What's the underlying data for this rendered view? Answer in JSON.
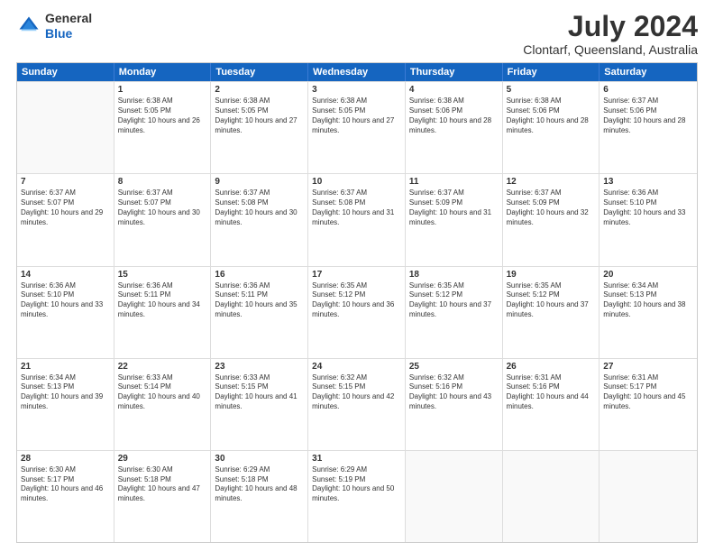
{
  "header": {
    "logo_general": "General",
    "logo_blue": "Blue",
    "month_title": "July 2024",
    "location": "Clontarf, Queensland, Australia"
  },
  "weekdays": [
    "Sunday",
    "Monday",
    "Tuesday",
    "Wednesday",
    "Thursday",
    "Friday",
    "Saturday"
  ],
  "weeks": [
    [
      {
        "day": "",
        "empty": true
      },
      {
        "day": "1",
        "sunrise": "6:38 AM",
        "sunset": "5:05 PM",
        "daylight": "10 hours and 26 minutes."
      },
      {
        "day": "2",
        "sunrise": "6:38 AM",
        "sunset": "5:05 PM",
        "daylight": "10 hours and 27 minutes."
      },
      {
        "day": "3",
        "sunrise": "6:38 AM",
        "sunset": "5:05 PM",
        "daylight": "10 hours and 27 minutes."
      },
      {
        "day": "4",
        "sunrise": "6:38 AM",
        "sunset": "5:06 PM",
        "daylight": "10 hours and 28 minutes."
      },
      {
        "day": "5",
        "sunrise": "6:38 AM",
        "sunset": "5:06 PM",
        "daylight": "10 hours and 28 minutes."
      },
      {
        "day": "6",
        "sunrise": "6:37 AM",
        "sunset": "5:06 PM",
        "daylight": "10 hours and 28 minutes."
      }
    ],
    [
      {
        "day": "7",
        "sunrise": "6:37 AM",
        "sunset": "5:07 PM",
        "daylight": "10 hours and 29 minutes."
      },
      {
        "day": "8",
        "sunrise": "6:37 AM",
        "sunset": "5:07 PM",
        "daylight": "10 hours and 30 minutes."
      },
      {
        "day": "9",
        "sunrise": "6:37 AM",
        "sunset": "5:08 PM",
        "daylight": "10 hours and 30 minutes."
      },
      {
        "day": "10",
        "sunrise": "6:37 AM",
        "sunset": "5:08 PM",
        "daylight": "10 hours and 31 minutes."
      },
      {
        "day": "11",
        "sunrise": "6:37 AM",
        "sunset": "5:09 PM",
        "daylight": "10 hours and 31 minutes."
      },
      {
        "day": "12",
        "sunrise": "6:37 AM",
        "sunset": "5:09 PM",
        "daylight": "10 hours and 32 minutes."
      },
      {
        "day": "13",
        "sunrise": "6:36 AM",
        "sunset": "5:10 PM",
        "daylight": "10 hours and 33 minutes."
      }
    ],
    [
      {
        "day": "14",
        "sunrise": "6:36 AM",
        "sunset": "5:10 PM",
        "daylight": "10 hours and 33 minutes."
      },
      {
        "day": "15",
        "sunrise": "6:36 AM",
        "sunset": "5:11 PM",
        "daylight": "10 hours and 34 minutes."
      },
      {
        "day": "16",
        "sunrise": "6:36 AM",
        "sunset": "5:11 PM",
        "daylight": "10 hours and 35 minutes."
      },
      {
        "day": "17",
        "sunrise": "6:35 AM",
        "sunset": "5:12 PM",
        "daylight": "10 hours and 36 minutes."
      },
      {
        "day": "18",
        "sunrise": "6:35 AM",
        "sunset": "5:12 PM",
        "daylight": "10 hours and 37 minutes."
      },
      {
        "day": "19",
        "sunrise": "6:35 AM",
        "sunset": "5:12 PM",
        "daylight": "10 hours and 37 minutes."
      },
      {
        "day": "20",
        "sunrise": "6:34 AM",
        "sunset": "5:13 PM",
        "daylight": "10 hours and 38 minutes."
      }
    ],
    [
      {
        "day": "21",
        "sunrise": "6:34 AM",
        "sunset": "5:13 PM",
        "daylight": "10 hours and 39 minutes."
      },
      {
        "day": "22",
        "sunrise": "6:33 AM",
        "sunset": "5:14 PM",
        "daylight": "10 hours and 40 minutes."
      },
      {
        "day": "23",
        "sunrise": "6:33 AM",
        "sunset": "5:15 PM",
        "daylight": "10 hours and 41 minutes."
      },
      {
        "day": "24",
        "sunrise": "6:32 AM",
        "sunset": "5:15 PM",
        "daylight": "10 hours and 42 minutes."
      },
      {
        "day": "25",
        "sunrise": "6:32 AM",
        "sunset": "5:16 PM",
        "daylight": "10 hours and 43 minutes."
      },
      {
        "day": "26",
        "sunrise": "6:31 AM",
        "sunset": "5:16 PM",
        "daylight": "10 hours and 44 minutes."
      },
      {
        "day": "27",
        "sunrise": "6:31 AM",
        "sunset": "5:17 PM",
        "daylight": "10 hours and 45 minutes."
      }
    ],
    [
      {
        "day": "28",
        "sunrise": "6:30 AM",
        "sunset": "5:17 PM",
        "daylight": "10 hours and 46 minutes."
      },
      {
        "day": "29",
        "sunrise": "6:30 AM",
        "sunset": "5:18 PM",
        "daylight": "10 hours and 47 minutes."
      },
      {
        "day": "30",
        "sunrise": "6:29 AM",
        "sunset": "5:18 PM",
        "daylight": "10 hours and 48 minutes."
      },
      {
        "day": "31",
        "sunrise": "6:29 AM",
        "sunset": "5:19 PM",
        "daylight": "10 hours and 50 minutes."
      },
      {
        "day": "",
        "empty": true
      },
      {
        "day": "",
        "empty": true
      },
      {
        "day": "",
        "empty": true
      }
    ]
  ]
}
